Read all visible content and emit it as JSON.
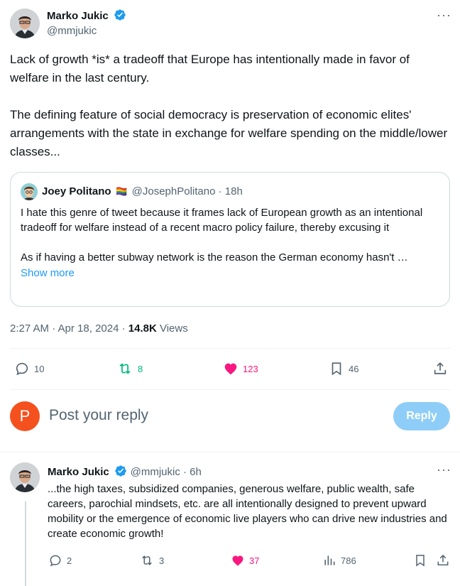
{
  "main_tweet": {
    "author_name": "Marko Jukic",
    "author_handle": "@mmjukic",
    "more_label": "···",
    "text_p1": "Lack of growth *is* a tradeoff that Europe has intentionally made in favor of welfare in the last century.",
    "text_p2": "The defining feature of social democracy is preservation of economic elites' arrangements with the state in exchange for welfare spending on the middle/lower classes...",
    "timestamp": "2:27 AM · Apr 18, 2024 · ",
    "views_count": "14.8K",
    "views_label": " Views",
    "replies": "10",
    "retweets": "8",
    "likes": "123",
    "bookmarks": "46"
  },
  "quote": {
    "author_name": "Joey Politano",
    "flag_emoji": "🏳️‍🌈",
    "author_handle": "@JosephPolitano · 18h",
    "text_p1": "I hate this genre of tweet because it frames lack of European growth as an intentional tradeoff for welfare instead of a recent macro policy failure, thereby excusing it",
    "text_p2": "As if having a better subway network is the reason the German economy hasn't …",
    "show_more": "Show more"
  },
  "compose": {
    "avatar_letter": "P",
    "placeholder": "Post your reply",
    "reply_button": "Reply"
  },
  "reply_tweet": {
    "author_name": "Marko Jukic",
    "author_handle": "@mmjukic · 6h",
    "more_label": "···",
    "text": "...the high taxes, subsidized companies, generous welfare, public wealth, safe careers, parochial mindsets, etc. are all intentionally designed to prevent upward mobility or the emergence of economic live players who can drive new industries and create economic growth!",
    "replies": "2",
    "retweets": "3",
    "likes": "37",
    "views": "786"
  },
  "colors": {
    "accent": "#1d9bf0",
    "like": "#f91880",
    "retweet": "#00ba7c",
    "compose_avatar": "#f4511e"
  }
}
